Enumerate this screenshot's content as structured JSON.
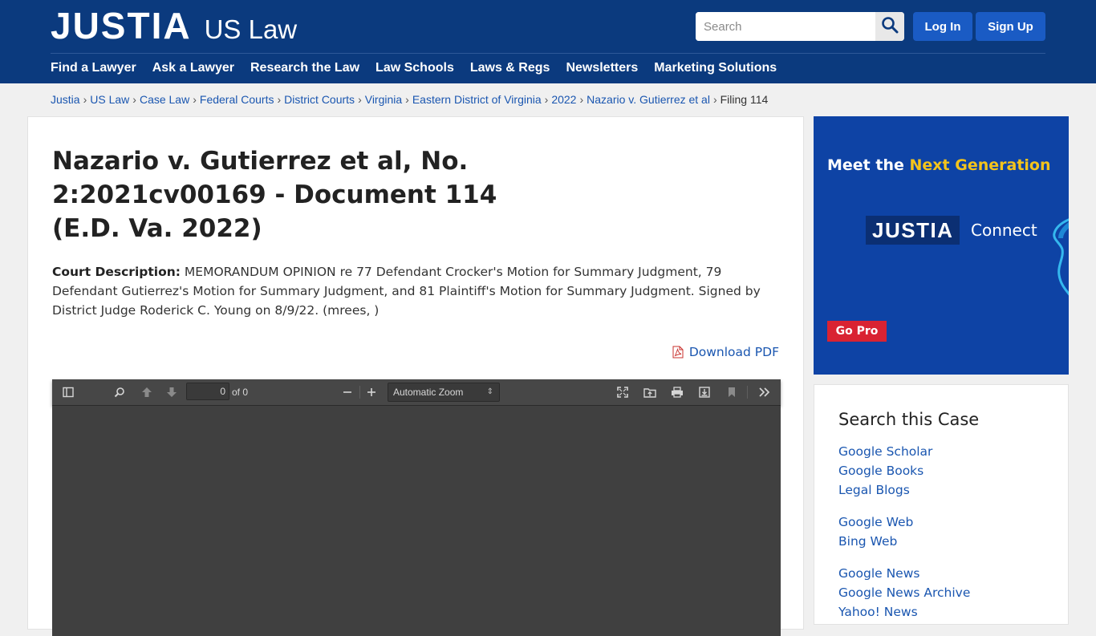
{
  "header": {
    "logo_main": "JUSTIA",
    "logo_sub": "US Law",
    "search_placeholder": "Search",
    "login_label": "Log In",
    "signup_label": "Sign Up",
    "nav": [
      "Find a Lawyer",
      "Ask a Lawyer",
      "Research the Law",
      "Law Schools",
      "Laws & Regs",
      "Newsletters",
      "Marketing Solutions"
    ]
  },
  "breadcrumb": {
    "items": [
      "Justia",
      "US Law",
      "Case Law",
      "Federal Courts",
      "District Courts",
      "Virginia",
      "Eastern District of Virginia",
      "2022",
      "Nazario v. Gutierrez et al"
    ],
    "current": "Filing 114",
    "separator": "›"
  },
  "main": {
    "title": "Nazario v. Gutierrez et al, No. 2:2021cv00169 - Document 114 (E.D. Va. 2022)",
    "description_label": "Court Description:",
    "description": "MEMORANDUM OPINION re 77 Defendant Crocker's Motion for Summary Judgment, 79 Defendant Gutierrez's Motion for Summary Judgment, and 81 Plaintiff's Motion for Summary Judgment. Signed by District Judge Roderick C. Young on 8/9/22. (mrees, )",
    "download_label": "Download PDF"
  },
  "viewer": {
    "page_value": "0",
    "page_of": "of 0",
    "zoom_label": "Automatic Zoom"
  },
  "ad": {
    "headline_prefix": "Meet the ",
    "headline_highlight": "Next Generation",
    "logo_main": "JUSTIA",
    "logo_sub": "Connect",
    "cta": "Go Pro"
  },
  "sidebar": {
    "title": "Search this Case",
    "links": [
      "Google Scholar",
      "Google Books",
      "Legal Blogs",
      "Google Web",
      "Bing Web",
      "Google News",
      "Google News Archive",
      "Yahoo! News"
    ]
  },
  "colors": {
    "header_bg": "#0b3a7e",
    "button_bg": "#1a5bc4",
    "link": "#1a56b0",
    "ad_bg": "#0e43a5",
    "ad_highlight": "#f4c41b",
    "cta_red": "#d92332",
    "viewer_bg": "#404040"
  },
  "icons": {
    "search": "magnifier-icon",
    "pdf": "pdf-file-icon",
    "sidebar_toggle": "sidebar-toggle-icon",
    "find": "find-icon",
    "prev_page": "arrow-up-icon",
    "next_page": "arrow-down-icon",
    "zoom_out": "minus-icon",
    "zoom_in": "plus-icon",
    "presentation": "fullscreen-icon",
    "open": "open-file-icon",
    "print": "print-icon",
    "download": "download-icon",
    "bookmark": "bookmark-icon",
    "tools": "double-chevron-right-icon"
  }
}
